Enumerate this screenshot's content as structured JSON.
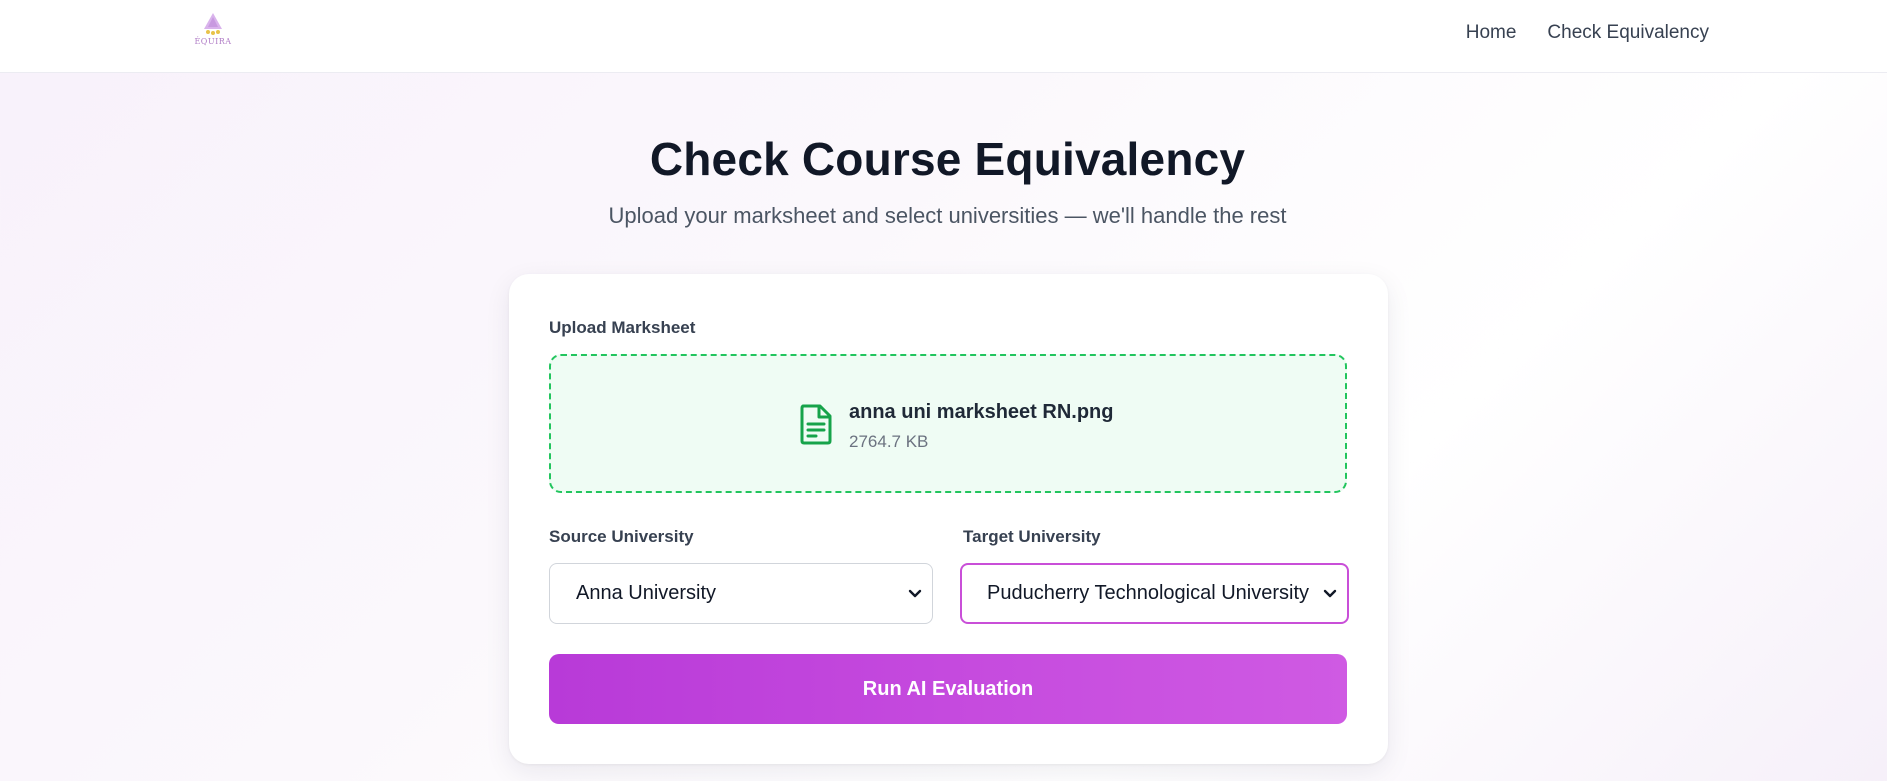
{
  "header": {
    "logo_text": "ÉQUIRA",
    "nav": [
      {
        "label": "Home"
      },
      {
        "label": "Check Equivalency"
      }
    ]
  },
  "hero": {
    "title": "Check Course Equivalency",
    "subtitle": "Upload your marksheet and select universities — we'll handle the rest"
  },
  "form": {
    "upload_label": "Upload Marksheet",
    "file": {
      "icon": "file-text-icon",
      "name": "anna uni marksheet RN.png",
      "size": "2764.7 KB"
    },
    "source_label": "Source University",
    "source_value": "Anna University",
    "target_label": "Target University",
    "target_value": "Puducherry Technological University",
    "submit_label": "Run AI Evaluation"
  },
  "colors": {
    "accent": "#c54ade",
    "upload_border": "#22c55e",
    "upload_bg": "#effcf4",
    "focus_border": "#c94fd8"
  }
}
